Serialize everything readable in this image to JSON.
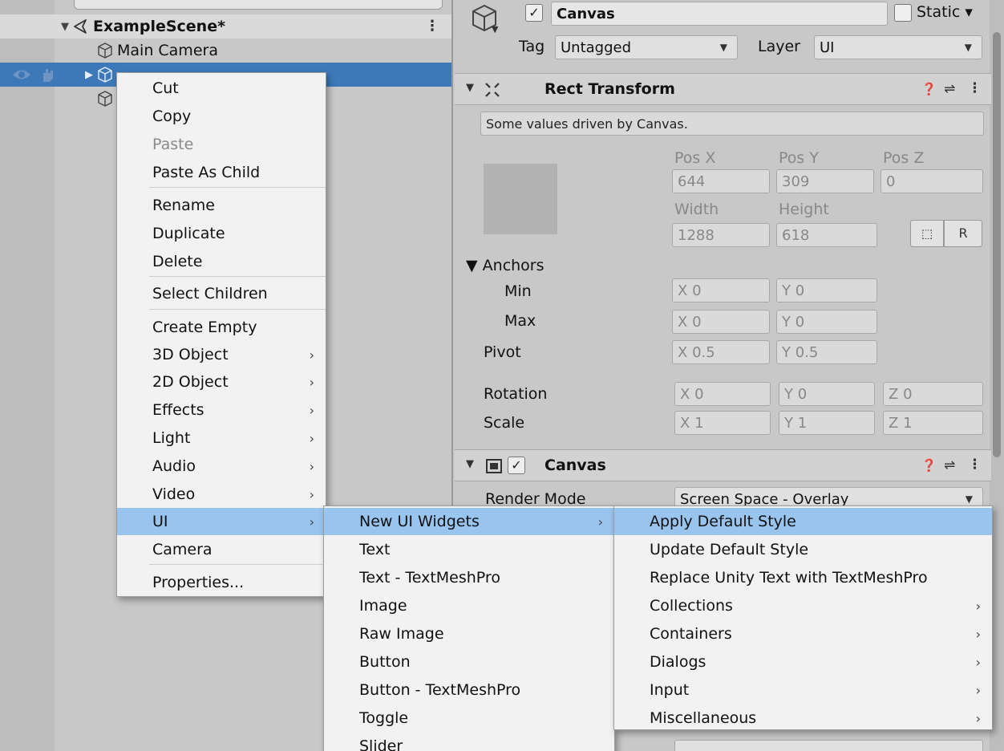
{
  "hierarchy": {
    "scene_name": "ExampleScene*",
    "items": [
      {
        "label": "Main Camera"
      }
    ]
  },
  "inspector": {
    "object_name": "Canvas",
    "active_check": "✓",
    "static_label": "Static ▾",
    "tag_label": "Tag",
    "tag_value": "Untagged",
    "layer_label": "Layer",
    "layer_value": "UI",
    "rect_transform": {
      "title": "Rect Transform",
      "info": "Some values driven by Canvas.",
      "pos_x_label": "Pos X",
      "pos_y_label": "Pos Y",
      "pos_z_label": "Pos Z",
      "pos_x": "644",
      "pos_y": "309",
      "pos_z": "0",
      "width_label": "Width",
      "height_label": "Height",
      "width": "1288",
      "height": "618",
      "r_button": "R",
      "anchors_label": "▼ Anchors",
      "min_label": "Min",
      "max_label": "Max",
      "min_x": "0",
      "min_y": "0",
      "max_x": "0",
      "max_y": "0",
      "pivot_label": "Pivot",
      "pivot_x": "0.5",
      "pivot_y": "0.5",
      "rotation_label": "Rotation",
      "rot_x": "0",
      "rot_y": "0",
      "rot_z": "0",
      "scale_label": "Scale",
      "scale_x": "1",
      "scale_y": "1",
      "scale_z": "1",
      "x": "X",
      "y": "Y",
      "z": "Z"
    },
    "canvas_component": {
      "title": "Canvas",
      "render_mode_label": "Render Mode",
      "render_mode_value": "Screen Space - Overlay"
    }
  },
  "context_menu": {
    "items": [
      {
        "label": "Cut"
      },
      {
        "label": "Copy"
      },
      {
        "label": "Paste"
      },
      {
        "label": "Paste As Child"
      },
      {
        "label": "Rename"
      },
      {
        "label": "Duplicate"
      },
      {
        "label": "Delete"
      },
      {
        "label": "Select Children"
      },
      {
        "label": "Create Empty"
      },
      {
        "label": "3D Object"
      },
      {
        "label": "2D Object"
      },
      {
        "label": "Effects"
      },
      {
        "label": "Light"
      },
      {
        "label": "Audio"
      },
      {
        "label": "Video"
      },
      {
        "label": "UI"
      },
      {
        "label": "Camera"
      },
      {
        "label": "Properties..."
      }
    ]
  },
  "ui_submenu": {
    "items": [
      {
        "label": "New UI Widgets"
      },
      {
        "label": "Text"
      },
      {
        "label": "Text - TextMeshPro"
      },
      {
        "label": "Image"
      },
      {
        "label": "Raw Image"
      },
      {
        "label": "Button"
      },
      {
        "label": "Button - TextMeshPro"
      },
      {
        "label": "Toggle"
      },
      {
        "label": "Slider"
      }
    ]
  },
  "widgets_submenu": {
    "items": [
      {
        "label": "Apply Default Style"
      },
      {
        "label": "Update Default Style"
      },
      {
        "label": "Replace Unity Text with TextMeshPro"
      },
      {
        "label": "Collections"
      },
      {
        "label": "Containers"
      },
      {
        "label": "Dialogs"
      },
      {
        "label": "Input"
      },
      {
        "label": "Miscellaneous"
      }
    ]
  },
  "glyphs": {
    "chevron": "›",
    "kebab": "⋮",
    "help": "❓",
    "presets": "⇌",
    "dropdown": "▼",
    "triangle_down": "▼",
    "triangle_right": "▶"
  },
  "colors": {
    "selection": "#3d79b8",
    "menu_highlight": "#99c4ee",
    "menu_bg": "#f2f2f2",
    "panel_bg": "#c8c8c8"
  }
}
